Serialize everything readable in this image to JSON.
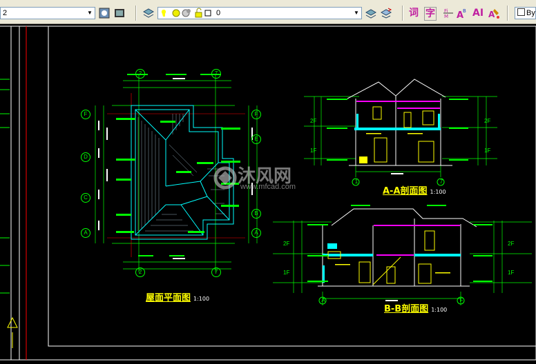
{
  "toolbar": {
    "style_combo_value": "2",
    "layer_combo_value": "0",
    "color_value": "By",
    "text_buttons": [
      "词",
      "字",
      "AI"
    ]
  },
  "drawing": {
    "roof_plan_title": "屋面平面图",
    "roof_plan_scale": "1:100",
    "section_aa_title": "A-A剖面图",
    "section_aa_scale": "1:100",
    "section_bb_title": "B-B剖面图",
    "section_bb_scale": "1:100",
    "grid_axis_labels": [
      "2",
      "7",
      "F",
      "E",
      "D",
      "C",
      "B",
      "A",
      "1",
      "A",
      "F"
    ],
    "floor_labels": [
      "2F",
      "1F",
      "2F",
      "1F",
      "2F",
      "1F",
      "2F",
      "1F"
    ]
  },
  "watermark": {
    "brand": "沐风网",
    "url": "www.mfcad.com"
  },
  "colors": {
    "toolbar_bg": "#ece9d8",
    "canvas_bg": "#000000",
    "frame_white": "#ffffff",
    "title_yellow": "#ffff00",
    "wall_cyan": "#00ffff",
    "dim_green": "#00ff00",
    "beam_magenta": "#ff00ff",
    "limit_red": "#ff0000"
  }
}
